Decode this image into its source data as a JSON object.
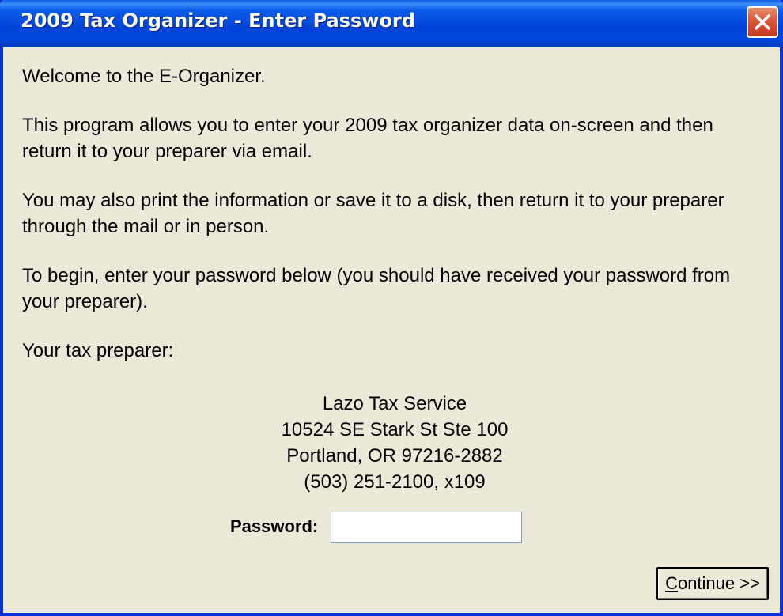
{
  "window": {
    "title": "2009 Tax Organizer - Enter Password",
    "close_icon": "close-icon"
  },
  "body": {
    "paragraphs": [
      "Welcome to the E-Organizer.",
      "This program allows you to enter your 2009 tax organizer data on-screen and then return it to your preparer via email.",
      "You may also print the information or save it to a disk, then return it to your preparer through the mail or in person.",
      "To begin, enter your password below (you should have received your password from your preparer).",
      "Your tax preparer:"
    ]
  },
  "preparer": {
    "name": "Lazo Tax Service",
    "address1": "10524 SE Stark St Ste 100",
    "address2": "Portland, OR 97216-2882",
    "phone": "(503) 251-2100, x109"
  },
  "form": {
    "password_label": "Password:",
    "password_value": ""
  },
  "buttons": {
    "continue_accel": "C",
    "continue_rest": "ontinue >>"
  },
  "colors": {
    "titlebar": "#0a5ae8",
    "window_bg": "#ece9d8",
    "close_button": "#d9533a"
  }
}
